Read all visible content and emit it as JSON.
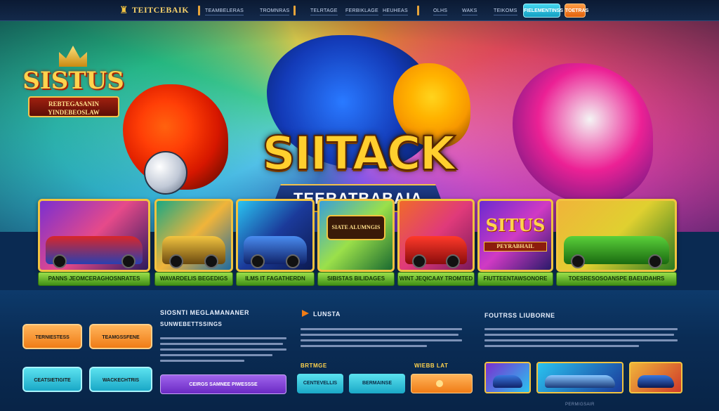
{
  "brand": {
    "name": "TEITCEBAIK",
    "icon": "trophy-icon"
  },
  "nav": {
    "links": [
      "TEAMBELERAS",
      "TROMNRAS",
      "TELRTAGE",
      "FERBIKLAGE",
      "HEUHEAS",
      "OLHS",
      "WAKS",
      "TEIKOMS"
    ],
    "login_label": "FIELEMENTINSS",
    "register_label": "TOETRAS"
  },
  "hero": {
    "logo_main": "SISTUS",
    "logo_ribbon_line1": "REBTEGASANIN",
    "logo_ribbon_line2": "YINDEBEOSLAW",
    "title": "SIITACK",
    "subtitle": "TEERATBABAIA"
  },
  "games": [
    {
      "label": "PANNS JEOMCERAGHOSNRATES",
      "theme": "purple"
    },
    {
      "label": "WAVARDELIS BEGEDIGS",
      "theme": "green"
    },
    {
      "label": "ILMS IT FAGATHERDN",
      "theme": "blue"
    },
    {
      "label": "SIBISTAS BILIDAGES",
      "theme": "gold",
      "sign": "SIATE ALUMNGIS"
    },
    {
      "label": "WINT JEQICAAY TROMTED",
      "theme": "red"
    },
    {
      "label": "FIUTTEENTAWSONORE",
      "theme": "situs",
      "sign": "SITUS",
      "sign_sub": "PEYRABHAIL"
    },
    {
      "label": "TOESRESOSOANSPE BAEUDAHRS",
      "theme": "lime"
    }
  ],
  "lower": {
    "left_buttons": [
      "TERNIESTESS",
      "TEAMGSSFENE",
      "CEATSIETIGITE",
      "WACKECHTRIS"
    ],
    "section1_heading_line1": "SIOSNTI MEGLAMANANER",
    "section1_heading_line2": "SUNWEBETTSSINGS",
    "section1_button": "CEIRGS SAMNEE PIWESSSE",
    "section2_heading": "LUNSTA",
    "section2_label": "BRTMGE",
    "section2_buttons": [
      "CENTEVELLIS",
      "BERMAINSE"
    ],
    "section3_label": "WIEBB LAT",
    "section3_button_icon": "flag-icon",
    "section4_heading": "FOUTRSS LIUBORNE",
    "footer": "PERMIGSAIR"
  },
  "colors": {
    "accent_gold": "#f2c440",
    "card_label_green": "#6cc234",
    "button_orange": "#f07c16",
    "button_cyan": "#1aa8c7",
    "button_purple": "#8a3cd4"
  }
}
